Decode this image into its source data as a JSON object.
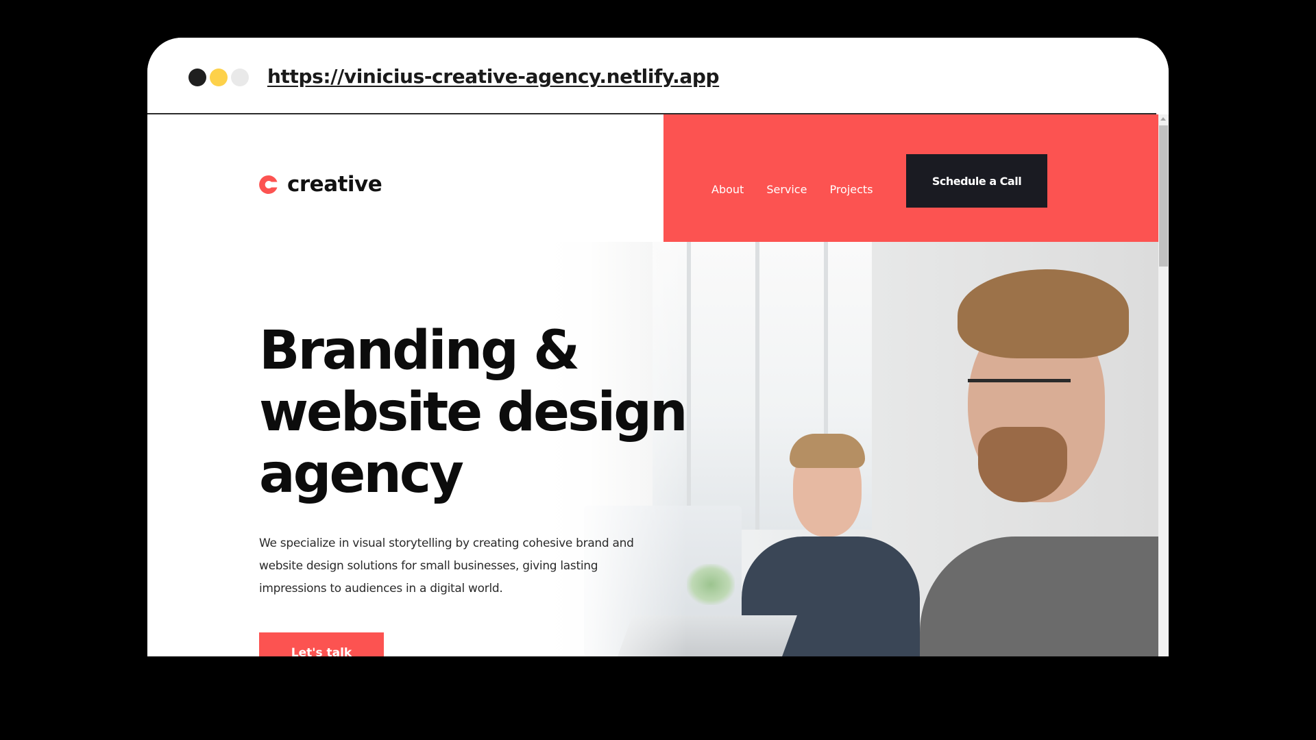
{
  "browser": {
    "url": "https://vinicius-creative-agency.netlify.app",
    "window_dots": [
      {
        "name": "close",
        "color": "#1f1f1f"
      },
      {
        "name": "minimize",
        "color": "#fdd14a"
      },
      {
        "name": "maximize",
        "color": "#e9e9e9"
      }
    ]
  },
  "site": {
    "logo_text": "creative",
    "logo_color": "#fc5351",
    "nav": {
      "links": [
        "About",
        "Service",
        "Projects"
      ],
      "cta_label": "Schedule a Call"
    },
    "hero": {
      "headline_lines": [
        "Branding &",
        "website design",
        "agency"
      ],
      "subtext_lines": [
        "We specialize in visual storytelling by creating cohesive brand and",
        "website design solutions for small businesses, giving lasting",
        "impressions to audiences in a digital world."
      ],
      "cta_label": "Let's talk",
      "image_icon": "office-photo-two-men-at-computers"
    }
  },
  "colors": {
    "accent": "#fc5351",
    "dark": "#1a1b22",
    "text": "#0c0c0c"
  }
}
